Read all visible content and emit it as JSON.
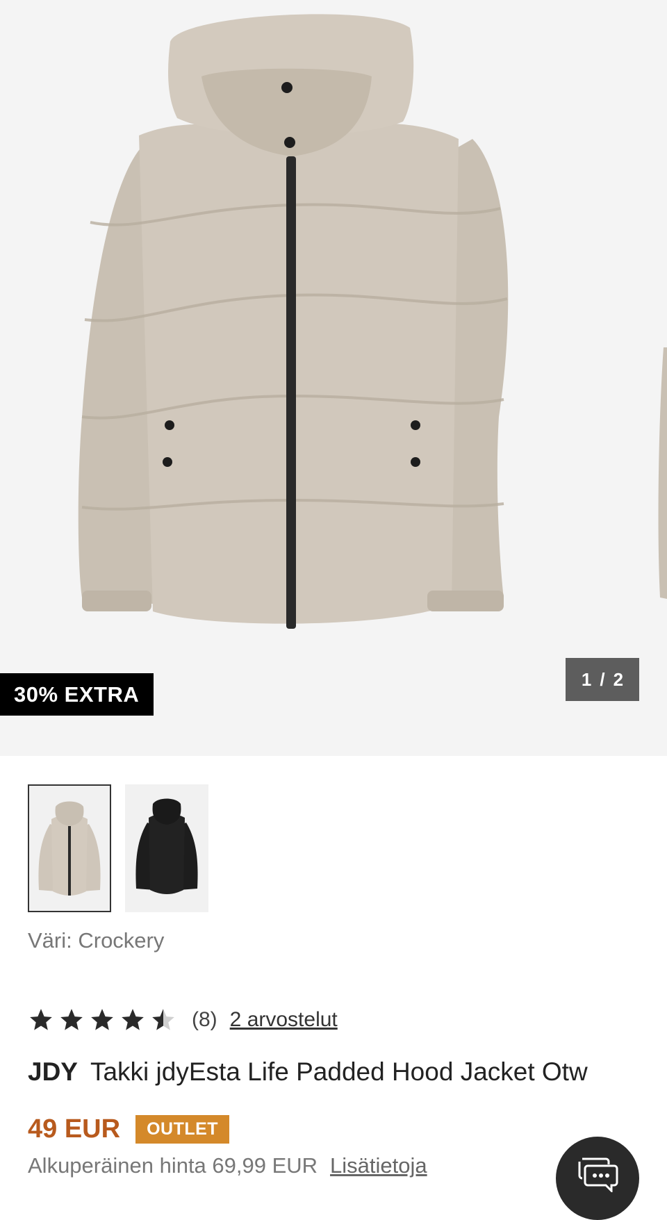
{
  "gallery": {
    "badge": "30% EXTRA",
    "counter": {
      "current": "1",
      "separator": "/",
      "total": "2"
    }
  },
  "thumbnails": [
    {
      "label": "Crockery",
      "color": "#cfc6ba",
      "selected": true
    },
    {
      "label": "Black",
      "color": "#1d1d1d",
      "selected": false
    }
  ],
  "product": {
    "color_text": "Väri: Crockery",
    "rating": {
      "value": 4.5,
      "max": 5,
      "count": "(8)",
      "reviews_link": "2 arvostelut"
    },
    "brand": "JDY",
    "name": "Takki jdyEsta Life Padded Hood Jacket Otw",
    "price": "49 EUR",
    "outlet_badge": "OUTLET",
    "original_price_text": "Alkuperäinen hinta 69,99 EUR",
    "more_info_link": "Lisätietoja"
  },
  "colors": {
    "price": "#b85a1d",
    "outlet": "#d4892a",
    "jacket": "#cfc6ba"
  },
  "icons": {
    "chat": "chat-bubbles-icon",
    "star": "star-icon"
  }
}
